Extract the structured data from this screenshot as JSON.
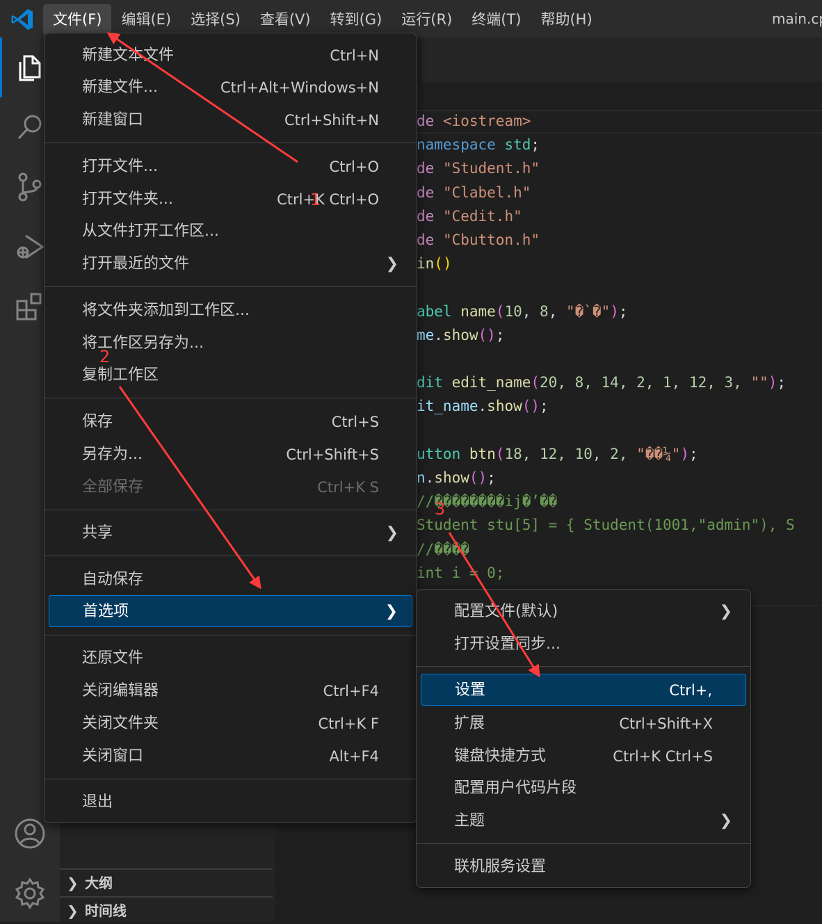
{
  "window": {
    "title": "main.cp"
  },
  "menubar": [
    {
      "label": "文件(F)",
      "active": true
    },
    {
      "label": "编辑(E)"
    },
    {
      "label": "选择(S)"
    },
    {
      "label": "查看(V)"
    },
    {
      "label": "转到(G)"
    },
    {
      "label": "运行(R)"
    },
    {
      "label": "终端(T)"
    },
    {
      "label": "帮助(H)"
    }
  ],
  "file_menu": [
    {
      "label": "新建文本文件",
      "shortcut": "Ctrl+N"
    },
    {
      "label": "新建文件...",
      "shortcut": "Ctrl+Alt+Windows+N"
    },
    {
      "label": "新建窗口",
      "shortcut": "Ctrl+Shift+N"
    },
    {
      "label": "打开文件...",
      "shortcut": "Ctrl+O"
    },
    {
      "label": "打开文件夹...",
      "shortcut": "Ctrl+K Ctrl+O"
    },
    {
      "label": "从文件打开工作区...",
      "shortcut": ""
    },
    {
      "label": "打开最近的文件",
      "shortcut": "",
      "submenu": true
    },
    {
      "label": "将文件夹添加到工作区...",
      "shortcut": ""
    },
    {
      "label": "将工作区另存为...",
      "shortcut": ""
    },
    {
      "label": "复制工作区",
      "shortcut": ""
    },
    {
      "label": "保存",
      "shortcut": "Ctrl+S"
    },
    {
      "label": "另存为...",
      "shortcut": "Ctrl+Shift+S"
    },
    {
      "label": "全部保存",
      "shortcut": "Ctrl+K S",
      "disabled": true
    },
    {
      "label": "共享",
      "shortcut": "",
      "submenu": true
    },
    {
      "label": "自动保存",
      "shortcut": ""
    },
    {
      "label": "首选项",
      "shortcut": "",
      "submenu": true,
      "highlighted": true
    },
    {
      "label": "还原文件",
      "shortcut": ""
    },
    {
      "label": "关闭编辑器",
      "shortcut": "Ctrl+F4"
    },
    {
      "label": "关闭文件夹",
      "shortcut": "Ctrl+K F"
    },
    {
      "label": "关闭窗口",
      "shortcut": "Alt+F4"
    },
    {
      "label": "退出",
      "shortcut": ""
    }
  ],
  "prefs_submenu": [
    {
      "label": "配置文件(默认)",
      "shortcut": "",
      "submenu": true
    },
    {
      "label": "打开设置同步...",
      "shortcut": ""
    },
    {
      "label": "设置",
      "shortcut": "Ctrl+,",
      "highlighted": true
    },
    {
      "label": "扩展",
      "shortcut": "Ctrl+Shift+X"
    },
    {
      "label": "键盘快捷方式",
      "shortcut": "Ctrl+K Ctrl+S"
    },
    {
      "label": "配置用户代码片段",
      "shortcut": ""
    },
    {
      "label": "主题",
      "shortcut": "",
      "submenu": true
    },
    {
      "label": "联机服务设置",
      "shortcut": ""
    }
  ],
  "sidebar": {
    "outline_label": "大纲",
    "timeline_label": "时间线"
  },
  "code": {
    "l1_a": "de ",
    "l1_b": "<iostream>",
    "l2_a": "namespace",
    "l2_b": " std",
    "l2_c": ";",
    "l3_a": "de ",
    "l3_b": "\"Student.h\"",
    "l4_a": "de ",
    "l4_b": "\"Clabel.h\"",
    "l5_a": "de ",
    "l5_b": "\"Cedit.h\"",
    "l6_a": "de ",
    "l6_b": "\"Cbutton.h\"",
    "l7_a": "in",
    "l7_b": "()",
    "l8_a": "abel",
    "l8_b": " name",
    "l8_c": "(",
    "l8_d": "10",
    "l8_e": ", ",
    "l8_f": "8",
    "l8_g": ", ",
    "l8_h": "\"�`�\"",
    "l8_i": ")",
    "l8_j": ";",
    "l9_a": "me",
    "l9_b": ".",
    "l9_c": "show",
    "l9_d": "()",
    "l9_e": ";",
    "l10_a": "dit",
    "l10_b": " edit_name",
    "l10_c": "(",
    "l10_d": "20, 8, 14, 2, 1, 12, 3, ",
    "l10_e": "\"\"",
    "l10_f": ")",
    "l10_g": ";",
    "l11_a": "it_name",
    "l11_b": ".",
    "l11_c": "show",
    "l11_d": "()",
    "l11_e": ";",
    "l12_a": "utton",
    "l12_b": " btn",
    "l12_c": "(",
    "l12_d": "18, 12, 10, 2, ",
    "l12_e": "\"��¼\"",
    "l12_f": ")",
    "l12_g": ";",
    "l13_a": "n",
    "l13_b": ".",
    "l13_c": "show",
    "l13_d": "()",
    "l13_e": ";",
    "l14": "//��������ij�’��",
    "l15": "Student stu[5] = { Student(1001,\"admin\"), S",
    "l16": "//����",
    "l17": "int i = 0;"
  },
  "annotations": {
    "step1": "1",
    "step2": "2",
    "step3": "3"
  },
  "colors": {
    "accent": "#0078d4",
    "highlight": "#04395e",
    "arrow": "#ff3b3b"
  }
}
